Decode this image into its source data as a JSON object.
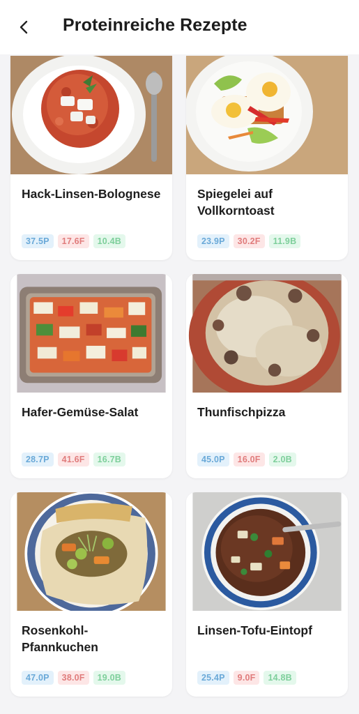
{
  "header": {
    "title": "Proteinreiche Rezepte",
    "back_icon": "chevron-left-icon"
  },
  "colors": {
    "protein": "#6aa9d8",
    "fat": "#e07c7c",
    "carbs": "#7ecf9b"
  },
  "recipes": [
    {
      "title": "Hack-Linsen-Bolognese",
      "protein": "37.5P",
      "fat": "17.6F",
      "carbs": "10.4B"
    },
    {
      "title": "Spiegelei auf Vollkorntoast",
      "protein": "23.9P",
      "fat": "30.2F",
      "carbs": "11.9B"
    },
    {
      "title": "Hafer-Gemüse-Salat",
      "protein": "28.7P",
      "fat": "41.6F",
      "carbs": "16.7B"
    },
    {
      "title": "Thunfischpizza",
      "protein": "45.0P",
      "fat": "16.0F",
      "carbs": "2.0B"
    },
    {
      "title": "Rosenkohl-Pfannkuchen",
      "protein": "47.0P",
      "fat": "38.0F",
      "carbs": "19.0B"
    },
    {
      "title": "Linsen-Tofu-Eintopf",
      "protein": "25.4P",
      "fat": "9.0F",
      "carbs": "14.8B"
    }
  ]
}
